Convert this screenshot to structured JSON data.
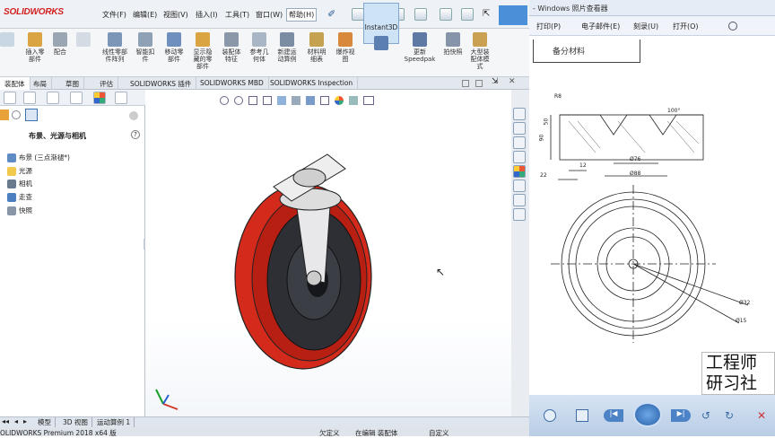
{
  "sw": {
    "logo": "SOLIDWORKS",
    "menus": [
      "文件(F)",
      "编辑(E)",
      "视图(V)",
      "插入(I)",
      "工具(T)",
      "窗口(W)",
      "帮助(H)"
    ],
    "ribbon": [
      {
        "label": "插入零\n部件"
      },
      {
        "label": "配合"
      },
      {
        "label": "线性零部\n件阵列"
      },
      {
        "label": "智能扣\n件"
      },
      {
        "label": "移动零\n部件"
      },
      {
        "label": "显示隐\n藏的零\n部件"
      },
      {
        "label": "装配体\n特征"
      },
      {
        "label": "参考几\n何体"
      },
      {
        "label": "新建运\n动算例"
      },
      {
        "label": "材料明\n细表"
      },
      {
        "label": "爆炸视\n图"
      },
      {
        "label": "Instant3D"
      },
      {
        "label": "更新\nSpeedpak"
      },
      {
        "label": "拍快照"
      },
      {
        "label": "大型装\n配体模\n式"
      }
    ],
    "tabs": [
      "装配体",
      "布局",
      "草图",
      "评估",
      "SOLIDWORKS 插件",
      "SOLIDWORKS MBD",
      "SOLIDWORKS Inspection"
    ],
    "active_tab": "装配体",
    "panel_title": "布景、光源与相机",
    "tree": [
      {
        "label": "布景 (三点渐褪*)",
        "icon": "scene-icon"
      },
      {
        "label": "光源",
        "icon": "light-icon"
      },
      {
        "label": "相机",
        "icon": "camera-icon"
      },
      {
        "label": "走查",
        "icon": "walkthrough-icon"
      },
      {
        "label": "快照",
        "icon": "snapshot-icon"
      }
    ],
    "bottom_tabs": [
      "模型",
      "3D 视图",
      "运动算例 1"
    ],
    "status_left": "OLIDWORKS Premium 2018 x64 版",
    "status_mid1": "欠定义",
    "status_mid2": "在编辑 装配体",
    "status_right": "自定义"
  },
  "viewer": {
    "title": "- Windows 照片查看器",
    "menus": [
      "打印(P)",
      "电子邮件(E)",
      "刻录(U)",
      "打开(O)"
    ],
    "drawing_header": "备分材料",
    "dims": {
      "d1": "50",
      "d2": "R8",
      "d3": "90",
      "d4": "12",
      "d5": "22",
      "d6": "Ø76",
      "d7": "Ø88",
      "d8": "100°",
      "d9": "Ø32",
      "d10": "Ø15"
    },
    "watermark": [
      "工程师",
      "研习社"
    ]
  }
}
